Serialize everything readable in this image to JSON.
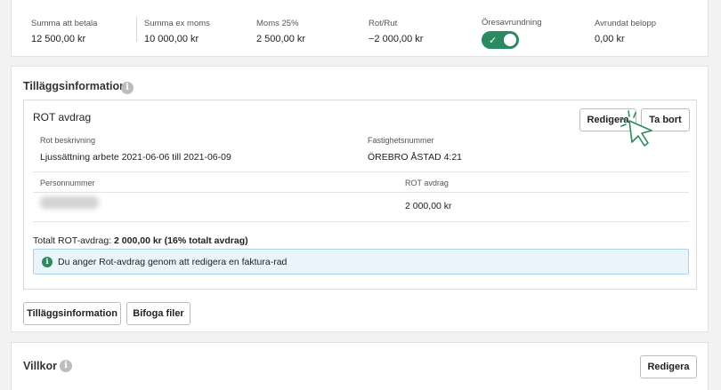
{
  "summary": {
    "to_pay_label": "Summa att betala",
    "to_pay_value": "12 500,00 kr",
    "ex_vat_label": "Summa ex moms",
    "ex_vat_value": "10 000,00 kr",
    "vat_label": "Moms 25%",
    "vat_value": "2 500,00 kr",
    "rotrut_label": "Rot/Rut",
    "rotrut_value": "−2 000,00 kr",
    "rounding_label": "Öresavrundning",
    "rounding_on": true,
    "rounded_label": "Avrundat belopp",
    "rounded_value": "0,00 kr"
  },
  "additional_info": {
    "title": "Tilläggsinformation",
    "rot": {
      "title": "ROT avdrag",
      "edit_label": "Redigera",
      "remove_label": "Ta bort",
      "desc_label": "Rot beskrivning",
      "desc_value": "Ljussättning arbete 2021-06-06 till 2021-06-09",
      "property_label": "Fastighetsnummer",
      "property_value": "ÖREBRO ÅSTAD 4:21",
      "personnummer_label": "Personnummer",
      "rot_label": "ROT avdrag",
      "rot_value": "2 000,00 kr",
      "total_prefix": "Totalt ROT-avdrag: ",
      "total_value": "2 000,00 kr (16% totalt avdrag)",
      "notice": "Du anger Rot-avdrag genom att redigera en faktura-rad"
    },
    "add_info_button": "Tilläggsinformation",
    "attach_button": "Bifoga filer"
  },
  "terms": {
    "title": "Villkor",
    "edit_label": "Redigera"
  },
  "colors": {
    "accent_green": "#2b8a5f",
    "notice_bg": "#e9f4fb"
  }
}
